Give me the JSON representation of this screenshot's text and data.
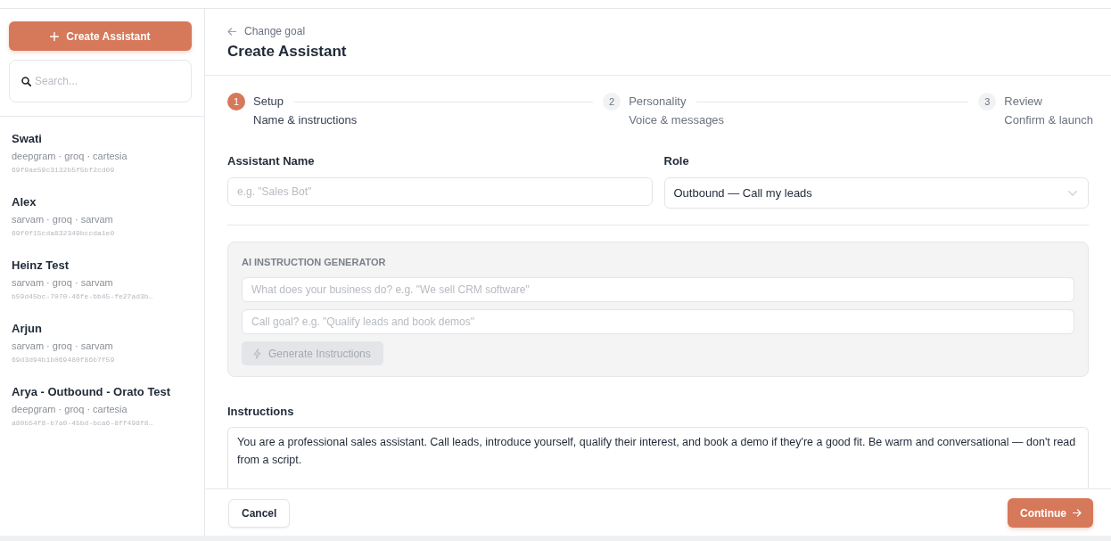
{
  "sidebar": {
    "create_button": {
      "label": "Create Assistant"
    },
    "search": {
      "placeholder": "Search..."
    },
    "assistants": [
      {
        "name": "Swati",
        "providers": "deepgram · groq · cartesia",
        "id": "69f9ae59c3132b5f5bf2cd09"
      },
      {
        "name": "Alex",
        "providers": "sarvam · groq · sarvam",
        "id": "69f0f15cda832349bccda1e0"
      },
      {
        "name": "Heinz Test",
        "providers": "sarvam · groq · sarvam",
        "id": "b59d45bc-7070-46fe-bb45-fe27ad3b…"
      },
      {
        "name": "Arjun",
        "providers": "sarvam · groq · sarvam",
        "id": "69d3d94b1b069480f86b7f59"
      },
      {
        "name": "Arya - Outbound - Orato Test",
        "providers": "deepgram · groq · cartesia",
        "id": "a80b54f8-b7a0-45bd-bca6-8ff498f8…"
      }
    ]
  },
  "header": {
    "back_link": "Change goal",
    "title": "Create Assistant"
  },
  "steps": [
    {
      "number": "1",
      "title": "Setup",
      "subtitle": "Name & instructions",
      "selected": true
    },
    {
      "number": "2",
      "title": "Personality",
      "subtitle": "Voice & messages",
      "selected": false
    },
    {
      "number": "3",
      "title": "Review",
      "subtitle": "Confirm & launch",
      "selected": false
    }
  ],
  "form": {
    "name_field": {
      "label": "Assistant Name",
      "placeholder": "e.g. \"Sales Bot\""
    },
    "role_field": {
      "label": "Role",
      "value": "Outbound — Call my leads"
    }
  },
  "generator": {
    "title": "AI INSTRUCTION GENERATOR",
    "fields": [
      {
        "placeholder": "What does your business do? e.g. \"We sell CRM software\""
      },
      {
        "placeholder": "Call goal? e.g. \"Qualify leads and book demos\""
      }
    ],
    "button": {
      "label": "Generate Instructions",
      "disabled": true
    }
  },
  "instructions": {
    "label": "Instructions",
    "value": "You are a professional sales assistant. Call leads, introduce yourself, qualify their interest, and book a demo if they're a good fit. Be warm and conversational — don't read from a script."
  },
  "footer": {
    "cancel": "Cancel",
    "continue": "Continue"
  }
}
